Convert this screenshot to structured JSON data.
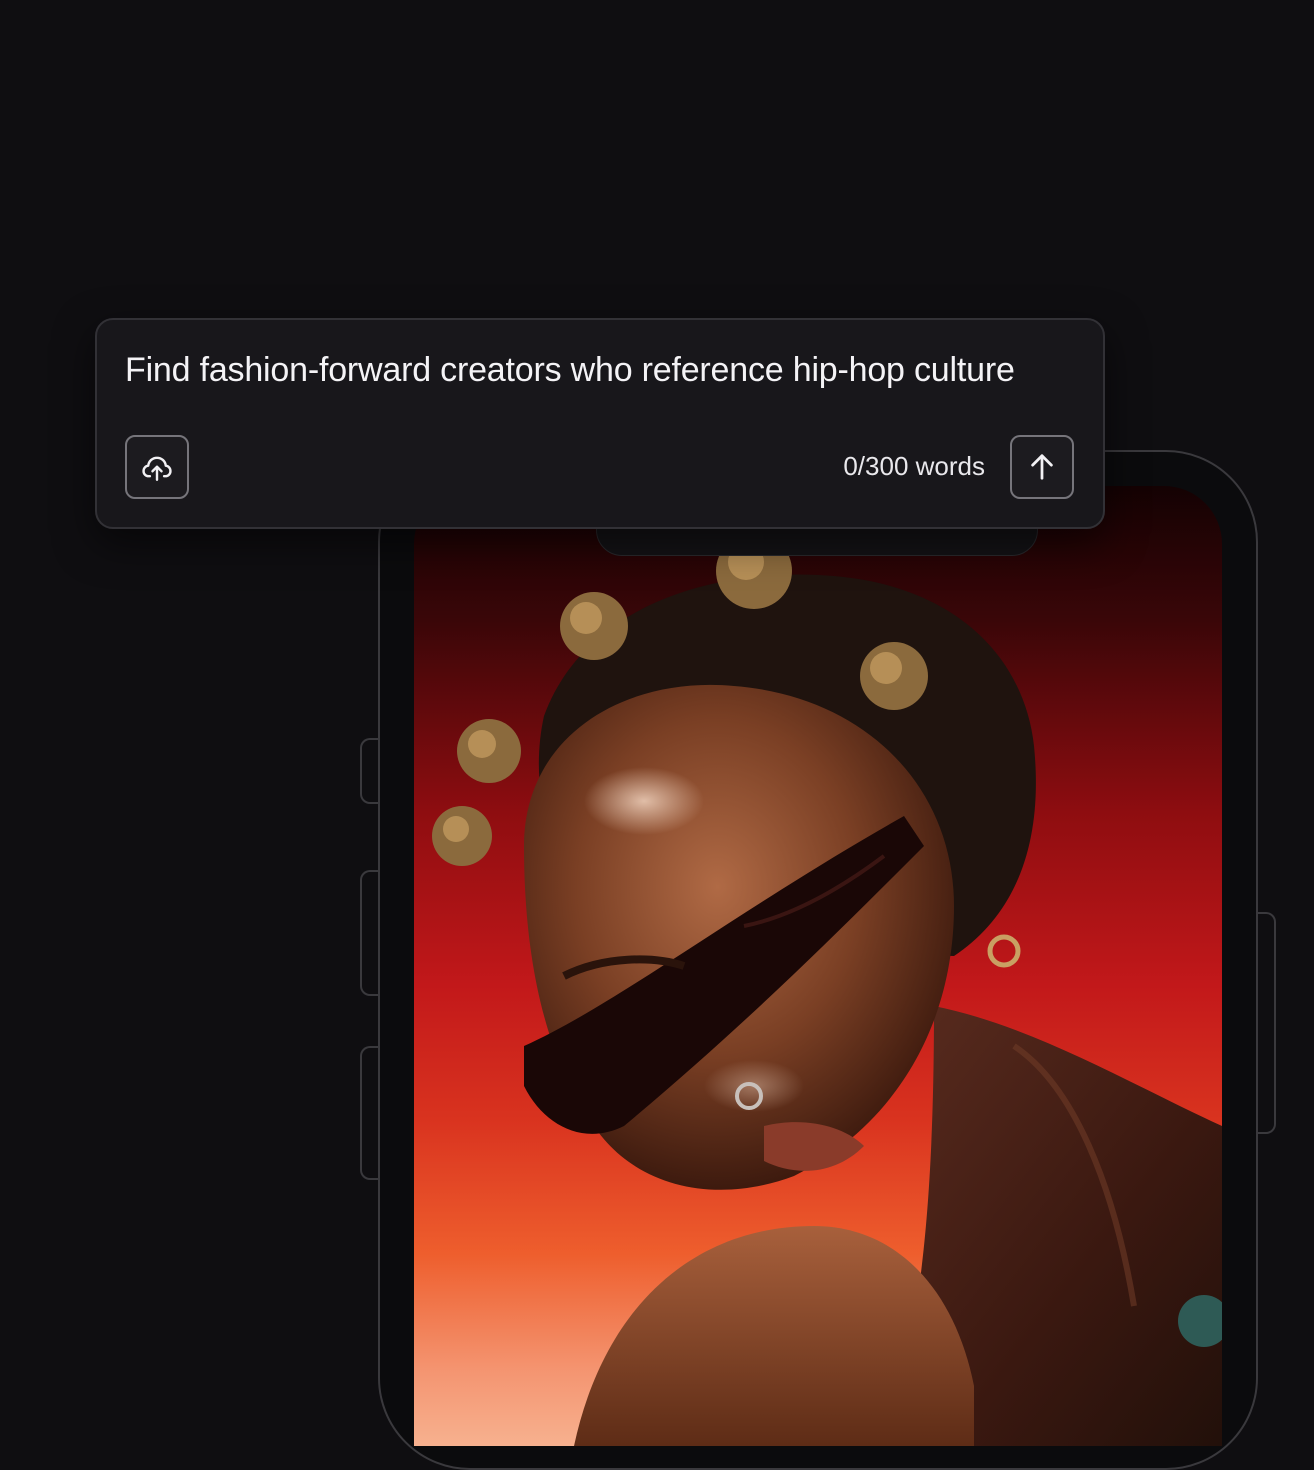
{
  "prompt": {
    "query_text": "Find fashion-forward creators who reference hip-hop culture",
    "word_count": "0/300 words",
    "upload_icon": "cloud-upload-icon",
    "send_icon": "arrow-up-icon"
  },
  "colors": {
    "background": "#0f0e11",
    "card": "#18171b",
    "card_border": "#323136",
    "text": "#f4f3f6",
    "photo_gradient_top": "#140203",
    "photo_gradient_mid": "#c2181a",
    "photo_gradient_bottom": "#f7b18f"
  }
}
